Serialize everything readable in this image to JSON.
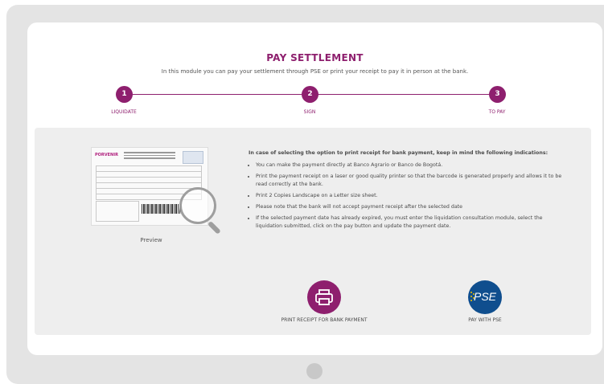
{
  "header": {
    "title": "PAY SETTLEMENT",
    "subtitle": "In this module you can pay your settlement through PSE or print your receipt to pay it in person at the bank."
  },
  "steps": [
    {
      "number": "1",
      "label": "LIQUIDATE"
    },
    {
      "number": "2",
      "label": "SIGN"
    },
    {
      "number": "3",
      "label": "TO PAY"
    }
  ],
  "preview": {
    "label": "Preview",
    "receipt_logo": "PORVENIR"
  },
  "info": {
    "intro": "In case of selecting the option to print receipt for bank payment, keep in mind the following indications:",
    "items": [
      "You can make the payment directly at Banco Agrario or Banco de Bogotá.",
      "Print the payment receipt on a laser or good quality printer so that the barcode is generated properly and allows it to be read correctly at the bank.",
      "Print 2 Copies Landscape on a Letter size sheet.",
      "Please note that the bank will not accept payment receipt after the selected date",
      "If the selected payment date has already expired, you must enter the liquidation consultation module, select the liquidation submitted, click on the pay button and update the payment date."
    ]
  },
  "actions": {
    "print_label": "PRINT RECEIPT FOR BANK PAYMENT",
    "pse_label": "PAY WITH PSE",
    "pse_logo_text": "pse"
  },
  "colors": {
    "accent": "#8e1f6e",
    "pse_blue": "#0f4e8e",
    "panel_bg": "#eeeeee"
  }
}
